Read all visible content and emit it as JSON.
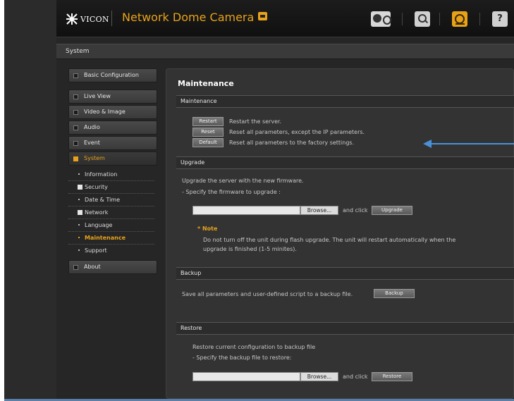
{
  "header": {
    "logo_text": "VICON",
    "title": "Network Dome Camera"
  },
  "section_bar": {
    "title": "System"
  },
  "sidebar": {
    "top_item": "Basic Configuration",
    "items": [
      "Live View",
      "Video & Image",
      "Audio",
      "Event",
      "System"
    ],
    "system_subitems": [
      "Information",
      "Security",
      "Date & Time",
      "Network",
      "Language",
      "Maintenance",
      "Support"
    ],
    "current_subitem": "Maintenance",
    "bottom_item": "About"
  },
  "main": {
    "page_title": "Maintenance",
    "maintenance": {
      "header": "Maintenance",
      "rows": [
        {
          "button": "Restart",
          "text": "Restart the server."
        },
        {
          "button": "Reset",
          "text": "Reset all parameters, except the IP parameters."
        },
        {
          "button": "Default",
          "text": "Reset all parameters to the factory settings."
        }
      ]
    },
    "upgrade": {
      "header": "Upgrade",
      "line1": "Upgrade the server with the new firmware.",
      "line2": "- Specify the firmware to upgrade :",
      "browse_label": "Browse...",
      "and_click": "and click",
      "button": "Upgrade",
      "note_title": "* Note",
      "note_line1": "Do not turn off the unit during flash upgrade. The unit will restart automatically when the",
      "note_line2": "upgrade is finished (1-5 minites)."
    },
    "backup": {
      "header": "Backup",
      "text": "Save all parameters and user-defined script to a backup file.",
      "button": "Backup"
    },
    "restore": {
      "header": "Restore",
      "line1": "Restore current configuration to backup file",
      "line2": "- Specify the backup file to restore:",
      "browse_label": "Browse...",
      "and_click": "and click",
      "button": "Restore"
    }
  },
  "colors": {
    "accent": "#e8a21a",
    "annotation_arrow": "#4a90d9"
  }
}
